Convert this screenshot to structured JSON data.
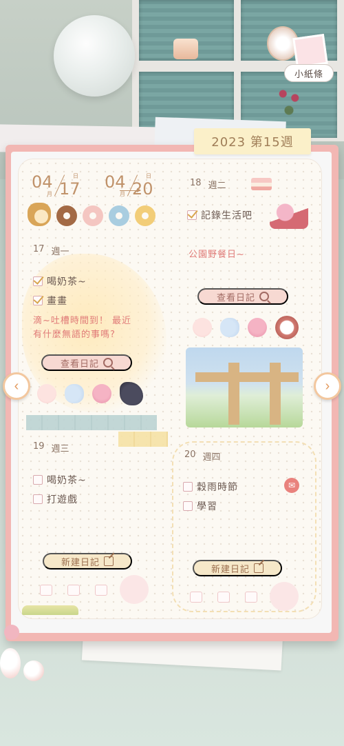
{
  "header": {
    "week_label": "2023 第15週",
    "note_button": "小紙條"
  },
  "date_range": {
    "start_month": "04",
    "start_day": "17",
    "end_month": "04",
    "end_day": "20",
    "month_unit": "月",
    "day_unit": "日"
  },
  "days": [
    {
      "date": "17",
      "weekday": "週一",
      "tasks": [
        {
          "label": "喝奶茶~",
          "checked": true
        },
        {
          "label": "畫畫",
          "checked": true
        }
      ],
      "note": "滴~吐槽時間到！ 最近\n有什麼無語的事嗎?",
      "view_diary": "查看日記"
    },
    {
      "date": "18",
      "weekday": "週二",
      "tasks": [
        {
          "label": "記錄生活吧",
          "checked": true
        }
      ],
      "note": "公園野餐日~",
      "view_diary": "查看日記"
    },
    {
      "date": "19",
      "weekday": "週三",
      "tasks": [
        {
          "label": "喝奶茶~",
          "checked": false
        },
        {
          "label": "打遊戲",
          "checked": false
        }
      ],
      "new_diary": "新建日記"
    },
    {
      "date": "20",
      "weekday": "週四",
      "tasks": [
        {
          "label": "穀雨時節",
          "checked": false
        },
        {
          "label": "學習",
          "checked": false
        }
      ],
      "new_diary": "新建日記"
    }
  ],
  "icons": {
    "prev": "chevron-left-icon",
    "next": "chevron-right-icon",
    "search": "search-icon",
    "edit": "edit-icon",
    "gift": "gift-icon"
  },
  "colors": {
    "notebook_border": "#f2b7b3",
    "paper": "#fcf9f3",
    "accent_text": "#e07b78",
    "week_tab": "#fbf0c9"
  }
}
